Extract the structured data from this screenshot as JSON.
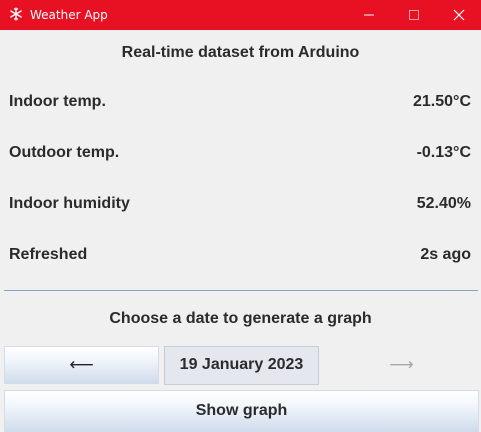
{
  "window": {
    "title": "Weather App",
    "icon": "snowflake-icon",
    "controls": [
      "minimize-icon",
      "maximize-icon",
      "close-icon"
    ],
    "titlebar_color": "#e81123"
  },
  "dataset": {
    "heading": "Real-time dataset from Arduino",
    "rows": [
      {
        "label": "Indoor temp.",
        "value": "21.50°C"
      },
      {
        "label": "Outdoor temp.",
        "value": "-0.13°C"
      },
      {
        "label": "Indoor humidity",
        "value": "52.40%"
      },
      {
        "label": "Refreshed",
        "value": "2s ago"
      }
    ]
  },
  "graph": {
    "heading": "Choose a date to generate a graph",
    "prev_arrow": "⟵",
    "date": "19 January 2023",
    "next_arrow": "⟶",
    "show_label": "Show graph"
  }
}
